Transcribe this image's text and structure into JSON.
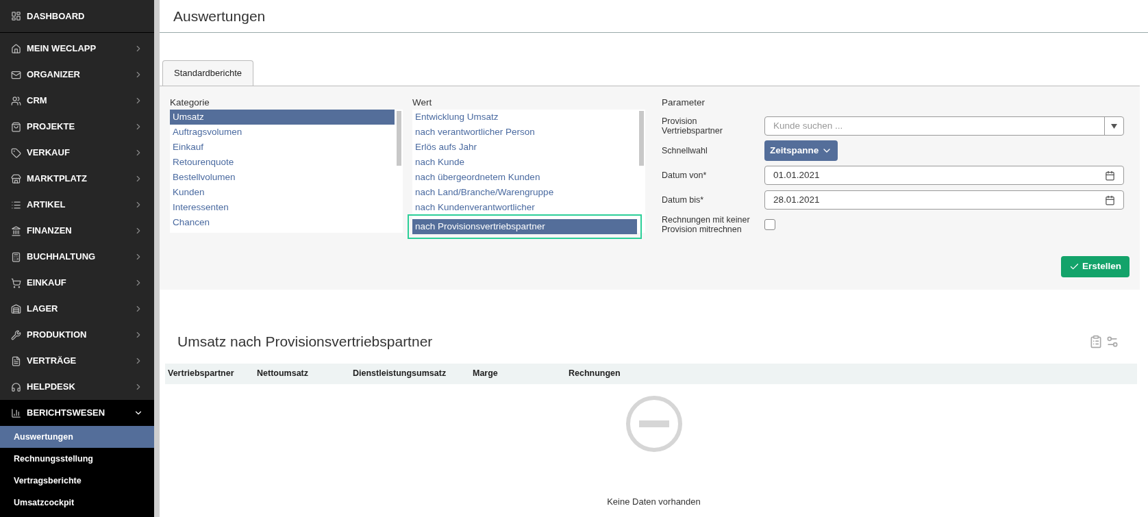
{
  "sidebar": {
    "items": [
      {
        "label": "DASHBOARD",
        "kind": "plain",
        "expanded": false
      },
      {
        "label": "MEIN WECLAPP",
        "kind": "group",
        "expanded": false
      },
      {
        "label": "ORGANIZER",
        "kind": "group",
        "expanded": false
      },
      {
        "label": "CRM",
        "kind": "group",
        "expanded": false
      },
      {
        "label": "PROJEKTE",
        "kind": "group",
        "expanded": false
      },
      {
        "label": "VERKAUF",
        "kind": "group",
        "expanded": false
      },
      {
        "label": "MARKTPLATZ",
        "kind": "group",
        "expanded": false
      },
      {
        "label": "ARTIKEL",
        "kind": "group",
        "expanded": false
      },
      {
        "label": "FINANZEN",
        "kind": "group",
        "expanded": false
      },
      {
        "label": "BUCHHALTUNG",
        "kind": "group",
        "expanded": false
      },
      {
        "label": "EINKAUF",
        "kind": "group",
        "expanded": false
      },
      {
        "label": "LAGER",
        "kind": "group",
        "expanded": false
      },
      {
        "label": "PRODUKTION",
        "kind": "group",
        "expanded": false
      },
      {
        "label": "VERTRÄGE",
        "kind": "group",
        "expanded": false
      },
      {
        "label": "HELPDESK",
        "kind": "group",
        "expanded": false
      },
      {
        "label": "BERICHTSWESEN",
        "kind": "group",
        "expanded": true,
        "children": [
          {
            "label": "Auswertungen",
            "selected": true
          },
          {
            "label": "Rechnungsstellung",
            "selected": false
          },
          {
            "label": "Vertragsberichte",
            "selected": false
          },
          {
            "label": "Umsatzcockpit",
            "selected": false
          }
        ]
      }
    ]
  },
  "page_title": "Auswertungen",
  "tabs": [
    {
      "label": "Standardberichte",
      "selected": true
    }
  ],
  "kategorie": {
    "label": "Kategorie",
    "items": [
      {
        "label": "Umsatz",
        "selected": true
      },
      {
        "label": "Auftragsvolumen",
        "selected": false
      },
      {
        "label": "Einkauf",
        "selected": false
      },
      {
        "label": "Retourenquote",
        "selected": false
      },
      {
        "label": "Bestellvolumen",
        "selected": false
      },
      {
        "label": "Kunden",
        "selected": false
      },
      {
        "label": "Interessenten",
        "selected": false
      },
      {
        "label": "Chancen",
        "selected": false
      }
    ]
  },
  "wert": {
    "label": "Wert",
    "items": [
      {
        "label": "Entwicklung Umsatz",
        "selected": false,
        "highlighted": false
      },
      {
        "label": "nach verantwortlicher Person",
        "selected": false,
        "highlighted": false
      },
      {
        "label": "Erlös aufs Jahr",
        "selected": false,
        "highlighted": false
      },
      {
        "label": "nach Kunde",
        "selected": false,
        "highlighted": false
      },
      {
        "label": "nach übergeordnetem Kunden",
        "selected": false,
        "highlighted": false
      },
      {
        "label": "nach Land/Branche/Warengruppe",
        "selected": false,
        "highlighted": false
      },
      {
        "label": "nach Kundenverantwortlicher",
        "selected": false,
        "highlighted": false
      },
      {
        "label": "nach Provisionsvertriebspartner",
        "selected": true,
        "highlighted": true
      }
    ]
  },
  "parameter": {
    "label": "Parameter",
    "fields": [
      {
        "kind": "combo",
        "label": "Provision Vertriebspartner",
        "placeholder": "Kunde suchen ..."
      },
      {
        "kind": "menu",
        "label": "Schnellwahl",
        "value": "Zeitspanne"
      },
      {
        "kind": "date",
        "label": "Datum von*",
        "value": "01.01.2021"
      },
      {
        "kind": "date",
        "label": "Datum bis*",
        "value": "28.01.2021"
      },
      {
        "kind": "checkbox",
        "label": "Rechnungen mit keiner Provision mitrechnen",
        "checked": false
      }
    ]
  },
  "create_button": "Erstellen",
  "report": {
    "title": "Umsatz nach Provisionsvertriebspartner",
    "columns": [
      "Vertriebspartner",
      "Nettoumsatz",
      "Dienstleistungsumsatz",
      "Marge",
      "Rechnungen"
    ],
    "empty_text": "Keine Daten vorhanden"
  }
}
